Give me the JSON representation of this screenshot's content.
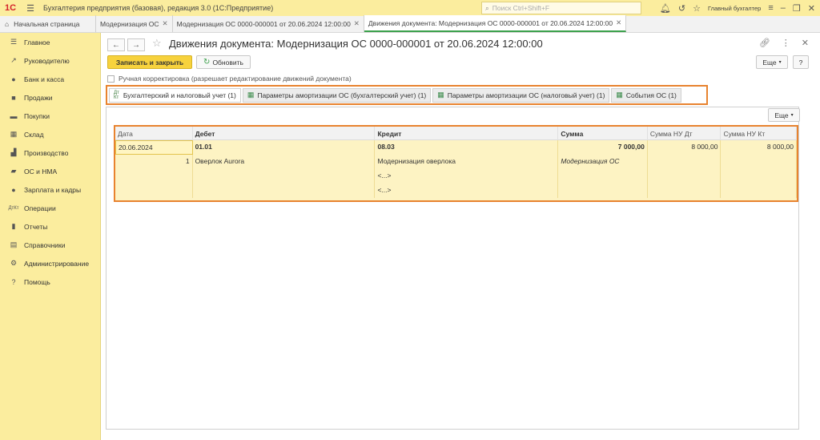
{
  "app": {
    "logo": "1С",
    "title": "Бухгалтерия предприятия (базовая), редакция 3.0  (1С:Предприятие)",
    "search_placeholder": "Поиск Ctrl+Shift+F",
    "user": "Главный бухгалтер"
  },
  "tabs": [
    {
      "label": "Начальная страница"
    },
    {
      "label": "Модернизация ОС"
    },
    {
      "label": "Модернизация ОС 0000-000001 от 20.06.2024 12:00:00"
    },
    {
      "label": "Движения документа: Модернизация ОС 0000-000001 от 20.06.2024 12:00:00"
    }
  ],
  "sidebar": {
    "items": [
      {
        "label": "Главное",
        "icon": "menu-icon"
      },
      {
        "label": "Руководителю",
        "icon": "trend-icon"
      },
      {
        "label": "Банк и касса",
        "icon": "coin-icon"
      },
      {
        "label": "Продажи",
        "icon": "bag-icon"
      },
      {
        "label": "Покупки",
        "icon": "cart-icon"
      },
      {
        "label": "Склад",
        "icon": "warehouse-icon"
      },
      {
        "label": "Производство",
        "icon": "factory-icon"
      },
      {
        "label": "ОС и НМА",
        "icon": "truck-icon"
      },
      {
        "label": "Зарплата и кадры",
        "icon": "person-icon"
      },
      {
        "label": "Операции",
        "icon": "dt-kt-icon"
      },
      {
        "label": "Отчеты",
        "icon": "chart-icon"
      },
      {
        "label": "Справочники",
        "icon": "book-icon"
      },
      {
        "label": "Администрирование",
        "icon": "gear-icon"
      },
      {
        "label": "Помощь",
        "icon": "question-icon"
      }
    ]
  },
  "document": {
    "title": "Движения документа: Модернизация ОС 0000-000001 от 20.06.2024 12:00:00",
    "save_close": "Записать и закрыть",
    "refresh": "Обновить",
    "more": "Еще",
    "help": "?",
    "manual_correction": "Ручная корректировка (разрешает редактирование движений документа)"
  },
  "doc_tabs": [
    {
      "label": "Бухгалтерский и налоговый учет (1)",
      "active": true
    },
    {
      "label": "Параметры амортизации ОС (бухгалтерский учет) (1)"
    },
    {
      "label": "Параметры амортизации ОС (налоговый учет) (1)"
    },
    {
      "label": "События ОС (1)"
    }
  ],
  "panel": {
    "more": "Еще"
  },
  "grid": {
    "headers": [
      "Дата",
      "Дебет",
      "Кредит",
      "Сумма",
      "Сумма НУ Дт",
      "Сумма НУ Кт"
    ],
    "row": {
      "date": "20.06.2024",
      "number": "1",
      "debit_account": "01.01",
      "debit_subconto1": "Оверлок Aurora",
      "credit_account": "08.03",
      "credit_subconto1": "Модернизация оверлока",
      "credit_subconto2": "<...>",
      "credit_subconto3": "<...>",
      "amount": "7 000,00",
      "amount_content": "Модернизация ОС",
      "nu_dt": "8 000,00",
      "nu_kt": "8 000,00"
    }
  },
  "colors": {
    "accent": "#f7d23d",
    "sidebar": "#fbed9e",
    "highlight": "#e8832f",
    "active_tab": "#3aa04a"
  }
}
